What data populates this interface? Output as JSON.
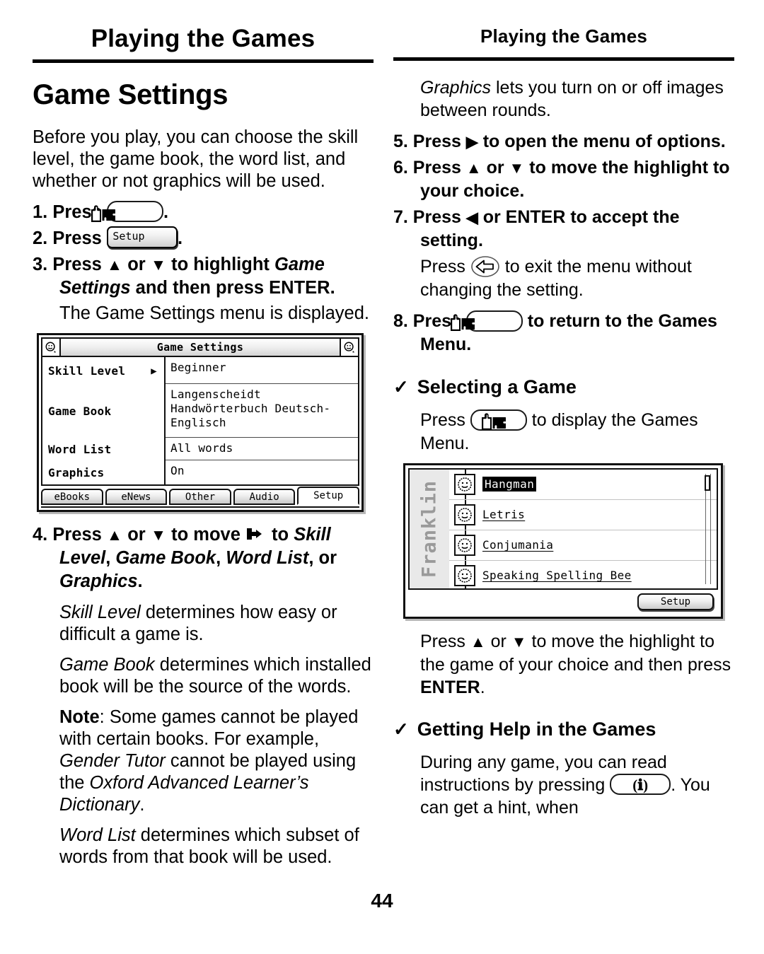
{
  "page": {
    "folio": "44",
    "running_head_left": "Playing the Games",
    "running_head_right": "Playing the Games"
  },
  "left_column": {
    "section_title": "Game Settings",
    "intro": "Before you play, you can choose the skill level, the game book, the word list, and whether or not graphics will be used.",
    "step1_label": "1. Press",
    "step1_after": ".",
    "step2_label": "2. Press",
    "step2_after": ".",
    "step3_a": "3. Press ",
    "step3_b": " or ",
    "step3_c": " to highlight ",
    "step3_italic": "Game Settings",
    "step3_d": " and then press ENTER.",
    "step3_note": "The Game Settings menu is displayed.",
    "step4_a": "4. Press ",
    "step4_b": " or ",
    "step4_c": " to move ",
    "step4_d": " to ",
    "step4_items_1": "Skill Level",
    "step4_sep1": ", ",
    "step4_items_2": "Game Book",
    "step4_sep2": ", ",
    "step4_items_3": "Word List",
    "step4_sep3": ", or ",
    "step4_items_4": "Graphics",
    "step4_end": ".",
    "para_skill_italic": "Skill Level",
    "para_skill_rest": " determines how easy or difficult a game is.",
    "para_book_italic": "Game Book",
    "para_book_rest": " determines which installed book will be the source of the words.",
    "note_label": "Note",
    "note_a": ": Some games cannot be played with certain books. For example, ",
    "note_italic_1": "Gender Tutor",
    "note_b": " cannot be played using the ",
    "note_italic_2": "Oxford Advanced Learner’s Dictionary",
    "note_c": ".",
    "para_word_italic": "Word List",
    "para_word_rest": " determines which subset of words from that book will be used."
  },
  "right_column": {
    "para_graphics_italic": "Graphics",
    "para_graphics_rest": " lets you turn on or off images between rounds.",
    "step5_a": "5. Press ",
    "step5_b": " to open the menu of options.",
    "step6_a": "6. Press ",
    "step6_b": " or ",
    "step6_c": " to move the highlight to your choice.",
    "step7_a": "7. Press ",
    "step7_b": " or ENTER to accept the setting.",
    "step7_note_a": "Press ",
    "step7_note_b": " to exit the menu without changing the setting.",
    "step8_a": "8. Press ",
    "step8_b": " to return to the Games Menu.",
    "heading_selecting": "Selecting a Game",
    "check_glyph": "✓",
    "selecting_a": "Press ",
    "selecting_b": " to display the Games Menu.",
    "after_menu_a": "Press ",
    "after_menu_b": " or ",
    "after_menu_c": " to move the highlight to the game of your choice and then press ",
    "after_menu_bold": "ENTER",
    "after_menu_d": ".",
    "heading_help": "Getting Help in the Games",
    "help_a": "During any game, you can read instructions by pressing ",
    "help_b": ". You can get a hint, when"
  },
  "arrows": {
    "up": "▲",
    "down": "▼",
    "right": "▶",
    "left": "◀"
  },
  "keys": {
    "games_key_name": "games-key",
    "setup_key_label": "Setup",
    "info_key_label": "(ℹ)",
    "back_key_name": "back-arrow-key"
  },
  "lcd_game_settings": {
    "title": "Game Settings",
    "rows": [
      {
        "label": "Skill Level",
        "cursor": "▶",
        "value": "Beginner"
      },
      {
        "label": "Game Book",
        "cursor": "",
        "value": "Langenscheidt Handwörterbuch Deutsch-Englisch"
      },
      {
        "label": "Word List",
        "cursor": "",
        "value": "All words"
      },
      {
        "label": "Graphics",
        "cursor": "",
        "value": "On"
      }
    ],
    "tabs": [
      {
        "label": "eBooks",
        "active": false
      },
      {
        "label": "eNews",
        "active": false
      },
      {
        "label": "Other",
        "active": false
      },
      {
        "label": "Audio",
        "active": false
      },
      {
        "label": "Setup",
        "active": true
      }
    ]
  },
  "lcd_games_menu": {
    "brand": "Franklin",
    "items": [
      {
        "label": "Hangman",
        "selected": true
      },
      {
        "label": "Letris",
        "selected": false
      },
      {
        "label": "Conjumania",
        "selected": false
      },
      {
        "label": "Speaking Spelling Bee",
        "selected": false
      }
    ],
    "setup_button": "Setup"
  }
}
